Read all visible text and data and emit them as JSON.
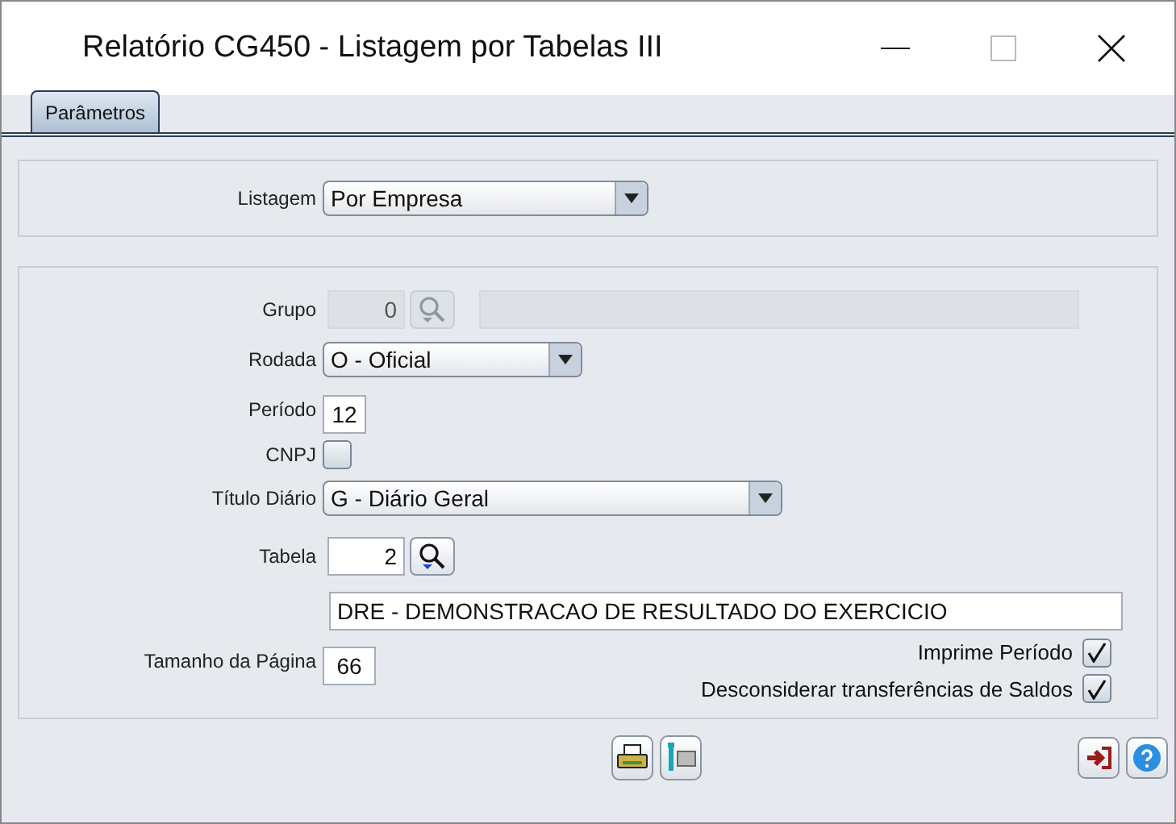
{
  "window": {
    "title": "Relatório CG450 - Listagem por Tabelas III"
  },
  "tabs": [
    {
      "label": "Parâmetros",
      "selected": true
    }
  ],
  "listagem": {
    "label": "Listagem",
    "value": "Por Empresa"
  },
  "fields": [
    {
      "kind": "lookup",
      "label": "Grupo",
      "value": "0",
      "disabled": true
    },
    {
      "kind": "select",
      "label": "Rodada",
      "value": "O - Oficial",
      "wide": false
    },
    {
      "kind": "number",
      "label": "Período",
      "value": "12"
    },
    {
      "kind": "checkbox",
      "label": "CNPJ",
      "checked": false
    },
    {
      "kind": "select",
      "label": "Título Diário",
      "value": "G - Diário Geral",
      "wide": true
    },
    {
      "kind": "lookup",
      "label": "Tabela",
      "value": "2",
      "disabled": false
    },
    {
      "kind": "text",
      "value": "DRE - DEMONSTRACAO DE RESULTADO DO EXERCICIO"
    }
  ],
  "page_size": {
    "label": "Tamanho da Página",
    "value": "66"
  },
  "options": [
    {
      "label": "Imprime Período",
      "checked": true
    },
    {
      "label": "Desconsiderar transferências de Saldos",
      "checked": true
    }
  ]
}
